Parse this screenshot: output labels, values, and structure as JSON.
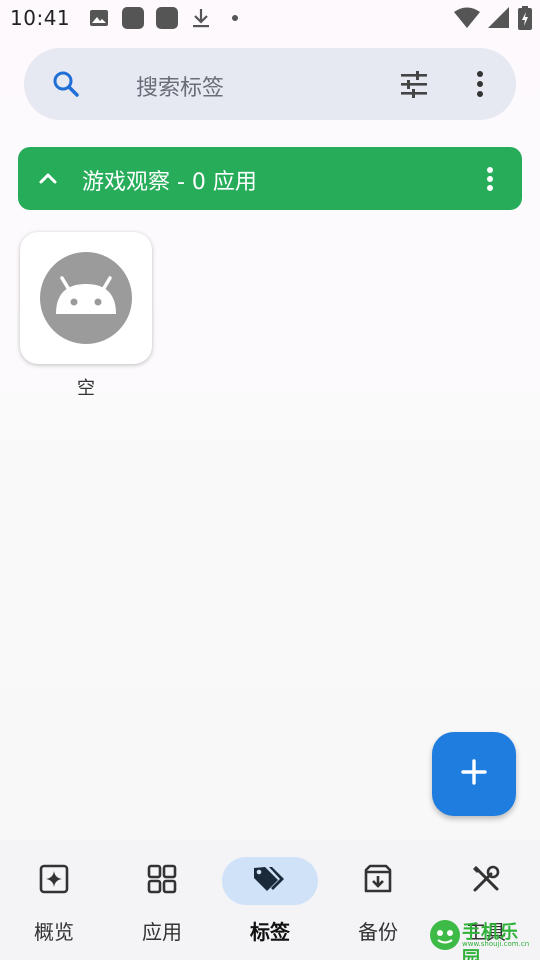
{
  "status_bar": {
    "time": "10:41",
    "icons_left": [
      "image-icon",
      "app-square-icon",
      "app-square-icon",
      "download-icon",
      "dot-icon"
    ],
    "icons_right": [
      "wifi-icon",
      "signal-icon",
      "battery-icon"
    ]
  },
  "search": {
    "placeholder": "搜索标签",
    "icons": [
      "search-icon",
      "filter-sliders-icon",
      "more-vert-icon"
    ]
  },
  "group": {
    "title": "游戏观察 - 0 应用",
    "color": "#27ad5a",
    "expanded": true
  },
  "apps": [
    {
      "label": "空",
      "icon": "android-default-icon"
    }
  ],
  "fab": {
    "icon": "plus-icon",
    "color": "#1f7de0"
  },
  "bottom_nav": {
    "active_index": 2,
    "items": [
      {
        "label": "概览",
        "icon": "sparkle-box-icon"
      },
      {
        "label": "应用",
        "icon": "grid-icon"
      },
      {
        "label": "标签",
        "icon": "tags-icon"
      },
      {
        "label": "备份",
        "icon": "archive-icon"
      },
      {
        "label": "工具",
        "icon": "tools-icon"
      }
    ]
  },
  "watermark": {
    "text": "手机乐园",
    "sub": "www.shouji.com.cn"
  }
}
